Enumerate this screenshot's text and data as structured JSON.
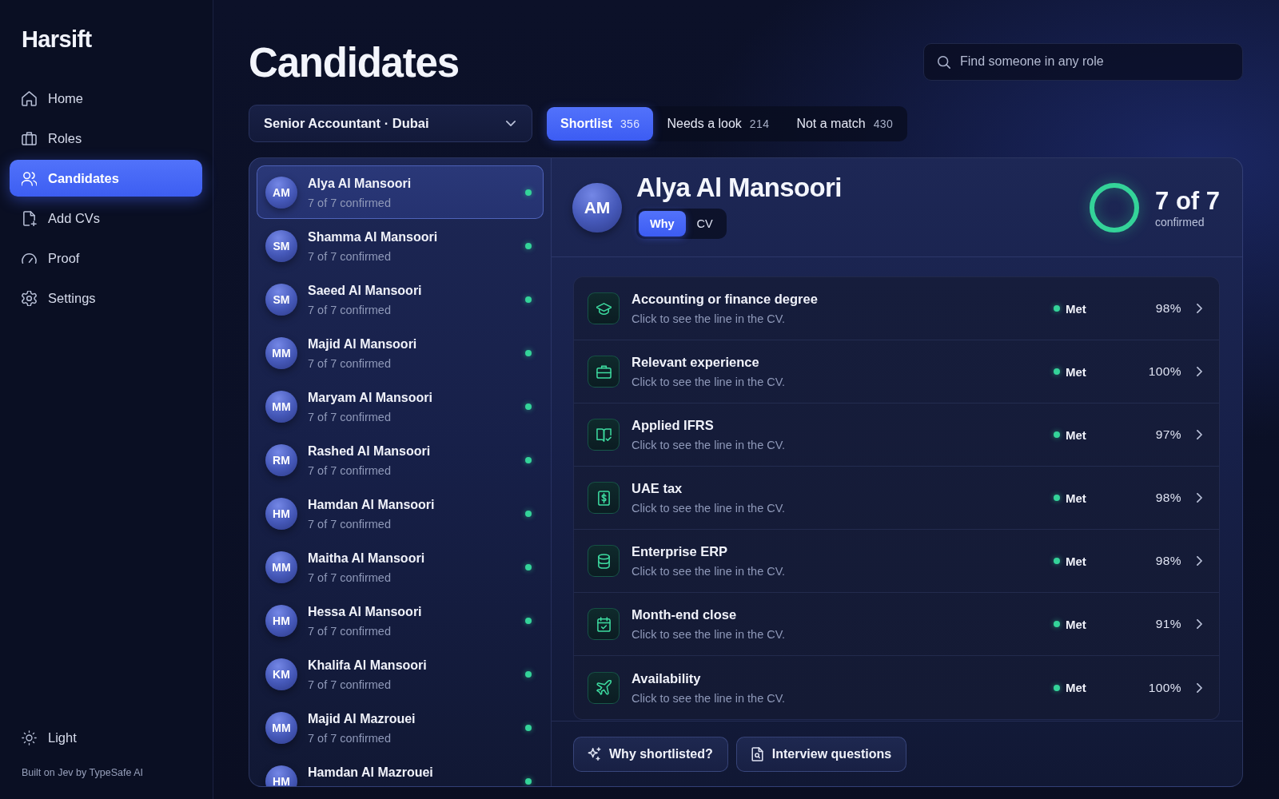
{
  "sidebar": {
    "logo": "Harsift",
    "items": [
      {
        "label": "Home",
        "selected": false
      },
      {
        "label": "Roles",
        "selected": false
      },
      {
        "label": "Candidates",
        "selected": true
      },
      {
        "label": "Add CVs",
        "selected": false
      },
      {
        "label": "Proof",
        "selected": false
      },
      {
        "label": "Settings",
        "selected": false
      }
    ],
    "theme_toggle": "Light",
    "footer": "Built on Jev by TypeSafe AI"
  },
  "header": {
    "title": "Candidates",
    "search": {
      "placeholder": "Find someone in any role"
    }
  },
  "role_select": {
    "value": "Senior Accountant · Dubai"
  },
  "tabs": [
    {
      "label": "Shortlist",
      "count": "356",
      "selected": true
    },
    {
      "label": "Needs a look",
      "count": "214",
      "selected": false
    },
    {
      "label": "Not a match",
      "count": "430",
      "selected": false
    }
  ],
  "candidates": [
    {
      "initials": "AM",
      "name": "Alya Al Mansoori",
      "summary": "7 of 7 confirmed",
      "selected": true
    },
    {
      "initials": "SM",
      "name": "Shamma Al Mansoori",
      "summary": "7 of 7 confirmed",
      "selected": false
    },
    {
      "initials": "SM",
      "name": "Saeed Al Mansoori",
      "summary": "7 of 7 confirmed",
      "selected": false
    },
    {
      "initials": "MM",
      "name": "Majid Al Mansoori",
      "summary": "7 of 7 confirmed",
      "selected": false
    },
    {
      "initials": "MM",
      "name": "Maryam Al Mansoori",
      "summary": "7 of 7 confirmed",
      "selected": false
    },
    {
      "initials": "RM",
      "name": "Rashed Al Mansoori",
      "summary": "7 of 7 confirmed",
      "selected": false
    },
    {
      "initials": "HM",
      "name": "Hamdan Al Mansoori",
      "summary": "7 of 7 confirmed",
      "selected": false
    },
    {
      "initials": "MM",
      "name": "Maitha Al Mansoori",
      "summary": "7 of 7 confirmed",
      "selected": false
    },
    {
      "initials": "HM",
      "name": "Hessa Al Mansoori",
      "summary": "7 of 7 confirmed",
      "selected": false
    },
    {
      "initials": "KM",
      "name": "Khalifa Al Mansoori",
      "summary": "7 of 7 confirmed",
      "selected": false
    },
    {
      "initials": "MM",
      "name": "Majid Al Mazrouei",
      "summary": "7 of 7 confirmed",
      "selected": false
    },
    {
      "initials": "HM",
      "name": "Hamdan Al Mazrouei",
      "selected": false
    }
  ],
  "detail": {
    "initials": "AM",
    "name": "Alya Al Mansoori",
    "views": [
      {
        "label": "Why",
        "selected": true
      },
      {
        "label": "CV",
        "selected": false
      }
    ],
    "score": {
      "value": "7 of 7",
      "caption": "confirmed",
      "level": 1
    },
    "criteria": [
      {
        "title": "Accounting or finance degree",
        "hint": "Click to see the line in the CV.",
        "status": "Met",
        "match": "98%"
      },
      {
        "title": "Relevant experience",
        "hint": "Click to see the line in the CV.",
        "status": "Met",
        "match": "100%"
      },
      {
        "title": "Applied IFRS",
        "hint": "Click to see the line in the CV.",
        "status": "Met",
        "match": "97%"
      },
      {
        "title": "UAE tax",
        "hint": "Click to see the line in the CV.",
        "status": "Met",
        "match": "98%"
      },
      {
        "title": "Enterprise ERP",
        "hint": "Click to see the line in the CV.",
        "status": "Met",
        "match": "98%"
      },
      {
        "title": "Month-end close",
        "hint": "Click to see the line in the CV.",
        "status": "Met",
        "match": "91%"
      },
      {
        "title": "Availability",
        "hint": "Click to see the line in the CV.",
        "status": "Met",
        "match": "100%"
      }
    ],
    "actions": [
      "Why shortlisted?",
      "Interview questions"
    ]
  }
}
